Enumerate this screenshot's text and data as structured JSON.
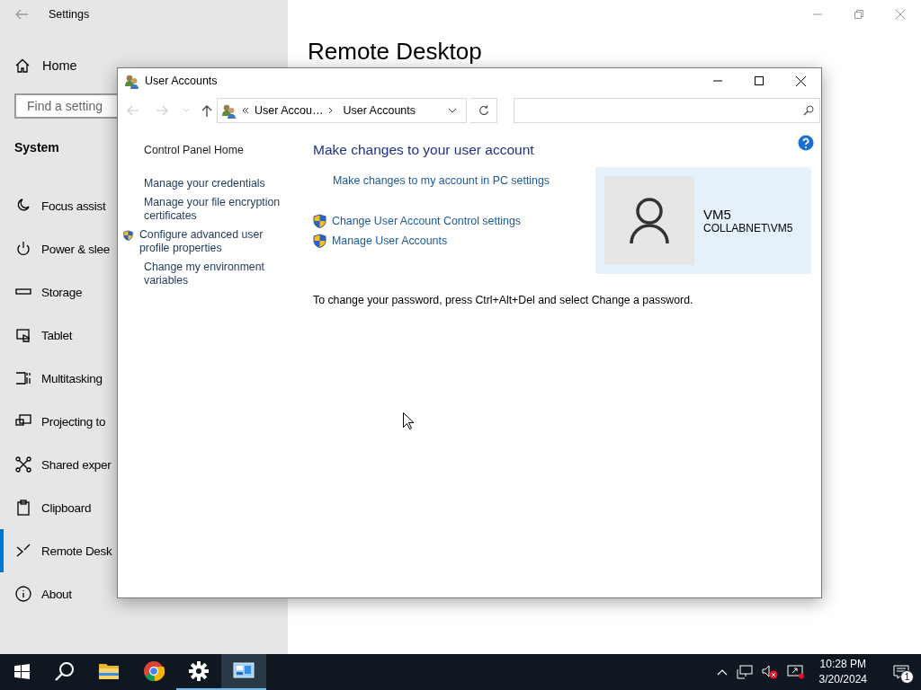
{
  "settings": {
    "title": "Settings",
    "home": "Home",
    "search": {
      "placeholder": "Find a setting"
    },
    "section": "System",
    "page_title": "Remote Desktop",
    "nav": [
      {
        "label": "Focus assist",
        "selected": false
      },
      {
        "label": "Power & slee",
        "selected": false
      },
      {
        "label": "Storage",
        "selected": false
      },
      {
        "label": "Tablet",
        "selected": false
      },
      {
        "label": "Multitasking",
        "selected": false
      },
      {
        "label": "Projecting to",
        "selected": false
      },
      {
        "label": "Shared exper",
        "selected": false
      },
      {
        "label": "Clipboard",
        "selected": false
      },
      {
        "label": "Remote Desk",
        "selected": true
      },
      {
        "label": "About",
        "selected": false
      }
    ]
  },
  "dialog": {
    "title": "User Accounts",
    "breadcrumb": [
      "User Accou…",
      "User Accounts"
    ],
    "sidebar": [
      {
        "label": "Control Panel Home",
        "kind": "home"
      },
      {
        "label": "Manage your credentials",
        "kind": "plain"
      },
      {
        "label": "Manage your file encryption certificates",
        "kind": "plain"
      },
      {
        "label": "Configure advanced user profile properties",
        "kind": "elevated"
      },
      {
        "label": "Change my environment variables",
        "kind": "plain"
      }
    ],
    "heading": "Make changes to your user account",
    "links": [
      {
        "label": "Make changes to my account in PC settings",
        "kind": "plain"
      },
      {
        "label": "Change User Account Control settings",
        "kind": "elevated"
      },
      {
        "label": "Manage User Accounts",
        "kind": "elevated"
      }
    ],
    "user": {
      "name": "VM5",
      "account": "COLLABNET\\VM5"
    },
    "note": "To change your password, press Ctrl+Alt+Del and select Change a password."
  },
  "taskbar": {
    "apps": [
      {
        "running": false,
        "selected": false
      },
      {
        "running": false,
        "selected": false
      },
      {
        "running": true,
        "selected": false
      },
      {
        "running": true,
        "selected": true
      }
    ],
    "volume": {
      "muted": true
    },
    "time": "10:28 PM",
    "date": "3/20/2024",
    "notifications": "1"
  }
}
